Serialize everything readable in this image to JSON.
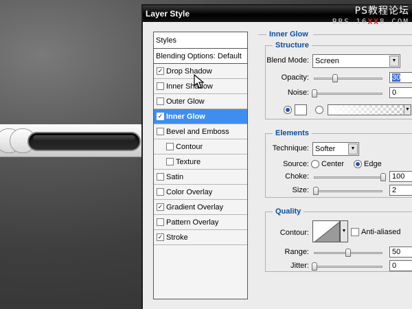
{
  "dialog": {
    "title": "Layer Style",
    "watermark_main": "PS教程论坛",
    "watermark_sub_prefix": "BBS.16",
    "watermark_sub_red": "XX",
    "watermark_sub_suffix": "8.COM"
  },
  "styles_panel": {
    "header": "Styles",
    "blending_options": "Blending Options: Default",
    "items": [
      {
        "label": "Drop Shadow",
        "checked": true
      },
      {
        "label": "Inner Shadow",
        "checked": false
      },
      {
        "label": "Outer Glow",
        "checked": false
      },
      {
        "label": "Inner Glow",
        "checked": true,
        "selected": true
      },
      {
        "label": "Bevel and Emboss",
        "checked": false
      },
      {
        "label": "Contour",
        "checked": false,
        "sub": true
      },
      {
        "label": "Texture",
        "checked": false,
        "sub": true
      },
      {
        "label": "Satin",
        "checked": false
      },
      {
        "label": "Color Overlay",
        "checked": false
      },
      {
        "label": "Gradient Overlay",
        "checked": true
      },
      {
        "label": "Pattern Overlay",
        "checked": false
      },
      {
        "label": "Stroke",
        "checked": true
      }
    ]
  },
  "inner_glow": {
    "heading": "Inner Glow",
    "structure": {
      "title": "Structure",
      "blend_mode_label": "Blend Mode:",
      "blend_mode_value": "Screen",
      "opacity_label": "Opacity:",
      "opacity_value": "30",
      "noise_label": "Noise:",
      "noise_value": "0"
    },
    "elements": {
      "title": "Elements",
      "technique_label": "Technique:",
      "technique_value": "Softer",
      "source_label": "Source:",
      "source_center": "Center",
      "source_edge": "Edge",
      "choke_label": "Choke:",
      "choke_value": "100",
      "size_label": "Size:",
      "size_value": "2"
    },
    "quality": {
      "title": "Quality",
      "contour_label": "Contour:",
      "anti_aliased_label": "Anti-aliased",
      "range_label": "Range:",
      "range_value": "50",
      "jitter_label": "Jitter:",
      "jitter_value": "0"
    }
  },
  "colors": {
    "accent_blue": "#0b4ea0",
    "selected_row": "#3e8ef0",
    "watermark_red": "#e02020"
  }
}
